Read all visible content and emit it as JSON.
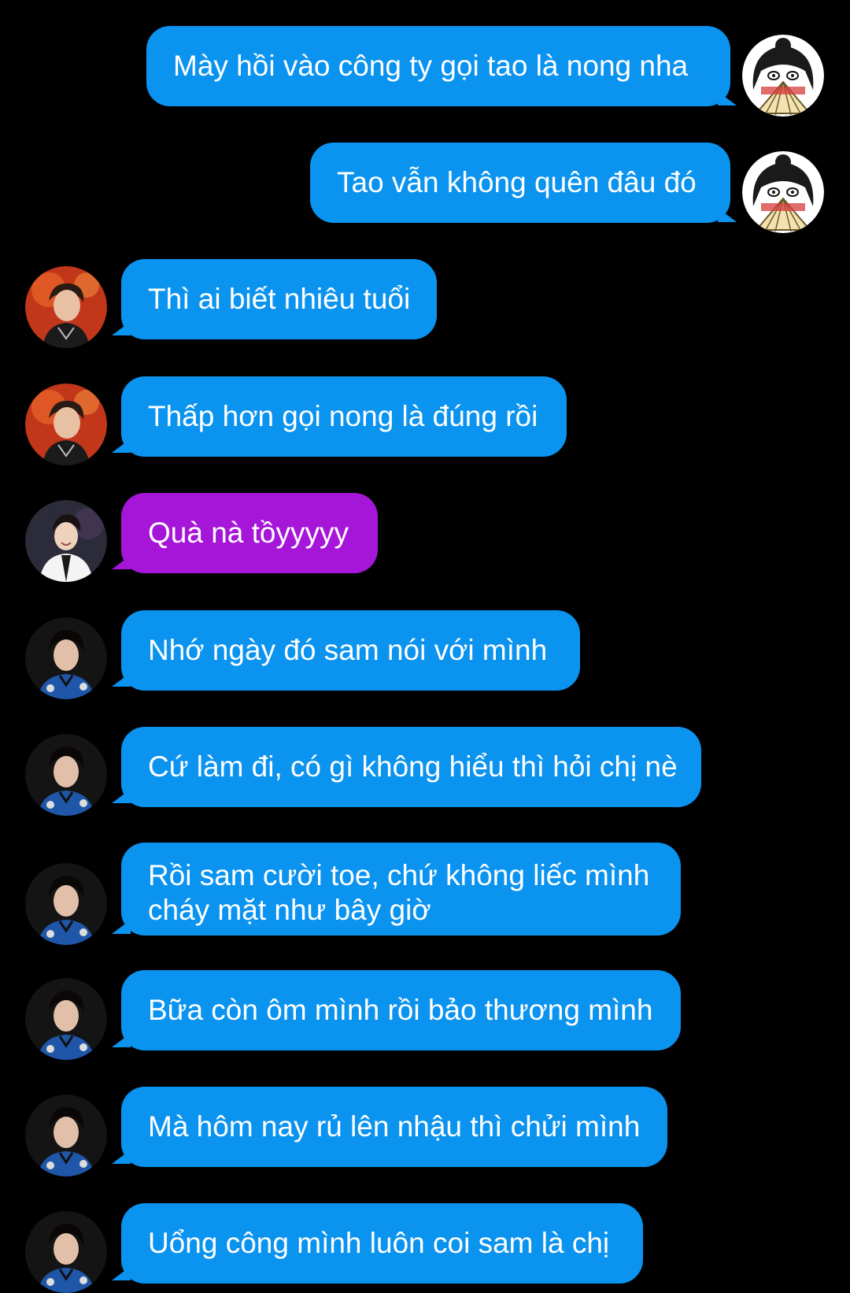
{
  "colors": {
    "background": "#000000",
    "bubble_blue": "#0b93f0",
    "bubble_purple": "#a616d8",
    "text": "#ffffff"
  },
  "messages": [
    {
      "side": "right",
      "avatar": "anime-fan-avatar",
      "color": "blue",
      "text": "Mày hồi vào công ty gọi tao là nong nha"
    },
    {
      "side": "right",
      "avatar": "anime-fan-avatar",
      "color": "blue",
      "text": "Tao vẫn không quên đâu đó"
    },
    {
      "side": "left",
      "avatar": "stage-singer-avatar",
      "color": "blue",
      "text": "Thì ai biết nhiêu tuổi"
    },
    {
      "side": "left",
      "avatar": "stage-singer-avatar",
      "color": "blue",
      "text": "Thấp hơn gọi nong là đúng rồi"
    },
    {
      "side": "left",
      "avatar": "white-suit-avatar",
      "color": "purple",
      "text": "Quà nà tồyyyyy"
    },
    {
      "side": "left",
      "avatar": "dark-portrait-avatar",
      "color": "blue",
      "text": "Nhớ ngày đó sam nói với mình"
    },
    {
      "side": "left",
      "avatar": "dark-portrait-avatar",
      "color": "blue",
      "text": "Cứ làm đi, có gì không hiểu thì hỏi chị nè"
    },
    {
      "side": "left",
      "avatar": "dark-portrait-avatar",
      "color": "blue",
      "text": "Rồi sam cười toe, chứ không liếc mình cháy mặt như bây giờ"
    },
    {
      "side": "left",
      "avatar": "dark-portrait-avatar",
      "color": "blue",
      "text": "Bữa còn ôm mình rồi bảo thương mình"
    },
    {
      "side": "left",
      "avatar": "dark-portrait-avatar",
      "color": "blue",
      "text": "Mà hôm nay rủ lên nhậu thì chửi mình"
    },
    {
      "side": "left",
      "avatar": "dark-portrait-avatar",
      "color": "blue",
      "text": "Uổng công mình luôn coi sam là chị"
    }
  ]
}
